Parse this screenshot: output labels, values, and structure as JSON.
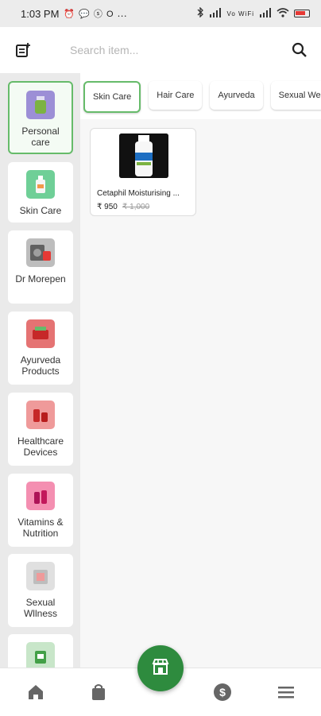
{
  "status_bar": {
    "time": "1:03 PM",
    "left_icons": "⏰ 💬 ⓢ O ⋯",
    "right_icons": "Vo WiFi"
  },
  "header": {
    "search_placeholder": "Search item..."
  },
  "sidebar": {
    "items": [
      {
        "label": "Personal care",
        "thumb_color": "#9c8fd6",
        "active": true
      },
      {
        "label": "Skin Care",
        "thumb_color": "#6fcf97"
      },
      {
        "label": "Dr Morepen",
        "thumb_color": "#bdbdbd"
      },
      {
        "label": "Ayurveda Products",
        "thumb_color": "#e57373"
      },
      {
        "label": "Healthcare Devices",
        "thumb_color": "#ef9a9a"
      },
      {
        "label": "Vitamins & Nutrition",
        "thumb_color": "#f48fb1"
      },
      {
        "label": "Sexual Wllness",
        "thumb_color": "#e0e0e0"
      },
      {
        "label": "",
        "thumb_color": "#43a047"
      }
    ]
  },
  "chips": [
    {
      "label": "Skin Care",
      "active": true
    },
    {
      "label": "Hair Care"
    },
    {
      "label": "Ayurveda"
    },
    {
      "label": "Sexual We"
    }
  ],
  "products": [
    {
      "name": "Cetaphil Moisturising ...",
      "price": "₹ 950",
      "mrp": "₹ 1,000"
    }
  ],
  "bottom_nav": [
    "home-icon",
    "bag-icon",
    "store-icon",
    "dollar-icon",
    "menu-icon"
  ],
  "colors": {
    "accent": "#66bb6a",
    "fab": "#2e8b3e"
  }
}
